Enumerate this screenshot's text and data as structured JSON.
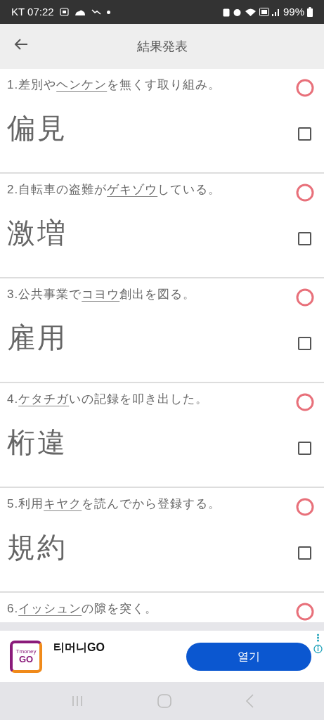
{
  "status_bar": {
    "carrier_time": "KT 07:22",
    "battery": "99%"
  },
  "app_bar": {
    "title": "結果発表"
  },
  "questions": [
    {
      "number": "1.",
      "before": "差別や",
      "underlined": "ヘンケン",
      "after": "を無くす取り組み。",
      "correct": true,
      "answer": "偏見",
      "checked": false
    },
    {
      "number": "2.",
      "before": "自転車の盗難が",
      "underlined": "ゲキゾウ",
      "after": "している。",
      "correct": true,
      "answer": "激増",
      "checked": false
    },
    {
      "number": "3.",
      "before": "公共事業で",
      "underlined": "コヨウ",
      "after": "創出を図る。",
      "correct": true,
      "answer": "雇用",
      "checked": false
    },
    {
      "number": "4.",
      "underlined": "ケタチガ",
      "after": "いの記録を叩き出した。",
      "correct": true,
      "answer": "桁違",
      "checked": false
    },
    {
      "number": "5.",
      "before": "利用",
      "underlined": "キヤク",
      "after": "を読んでから登録する。",
      "correct": true,
      "answer": "規約",
      "checked": false
    },
    {
      "number": "6.",
      "underlined": "イッシュン",
      "after": "の隙を突く。",
      "correct": true
    }
  ],
  "ad": {
    "icon_texts": [
      "Tmoney",
      "GO"
    ],
    "app_name": "티머니GO",
    "button": "열기"
  }
}
